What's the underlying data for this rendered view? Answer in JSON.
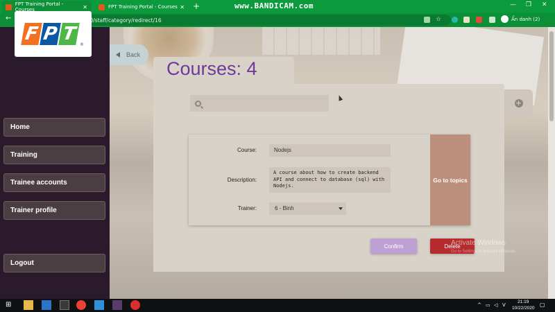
{
  "browser": {
    "tabs": [
      {
        "title": "FPT Training Portal - Courses",
        "active": true
      },
      {
        "title": "FPT Training Portal - Courses",
        "active": false
      }
    ],
    "new_tab_label": "+",
    "recorder_watermark": "www.BANDICAM.com",
    "window_controls": {
      "minimize": "—",
      "maximize": "❐",
      "close": "✕"
    },
    "nav": {
      "back": "←",
      "forward": "→",
      "reload": "C"
    },
    "url": "localhost:8080/staff/category/redirect/16",
    "profile_label": "Ẩn danh (2)",
    "theme_color": "#0b9a3c"
  },
  "sidebar": {
    "logo_letters": [
      "F",
      "P",
      "T"
    ],
    "logo_colors": [
      "#f37021",
      "#0a57a4",
      "#4db848"
    ],
    "logo_registered": "®",
    "items": [
      {
        "label": "Home"
      },
      {
        "label": "Training"
      },
      {
        "label": "Trainee accounts"
      },
      {
        "label": "Trainer profile"
      }
    ],
    "logout_label": "Logout",
    "bg_color": "#2b1a2c"
  },
  "main": {
    "back_label": "Back",
    "title": "Courses: 4",
    "search_placeholder": "",
    "add_icon": "+",
    "course": {
      "course_label": "Course:",
      "course_value": "Nodejs",
      "description_label": "Description:",
      "description_value": "A course about how to create backend API and connect to database (sql) with Nodejs.",
      "trainer_label": "Trainer:",
      "trainer_value": "6 - Binh",
      "topics_label": "Go to topics"
    },
    "confirm_label": "Confirm",
    "delete_label": "Delete",
    "accent_color": "#6d3a9c"
  },
  "os": {
    "watermark": "Activate Windows",
    "watermark_sub": "Go to Settings to activate Windows.",
    "time": "21:19",
    "date": "10/22/2020"
  }
}
